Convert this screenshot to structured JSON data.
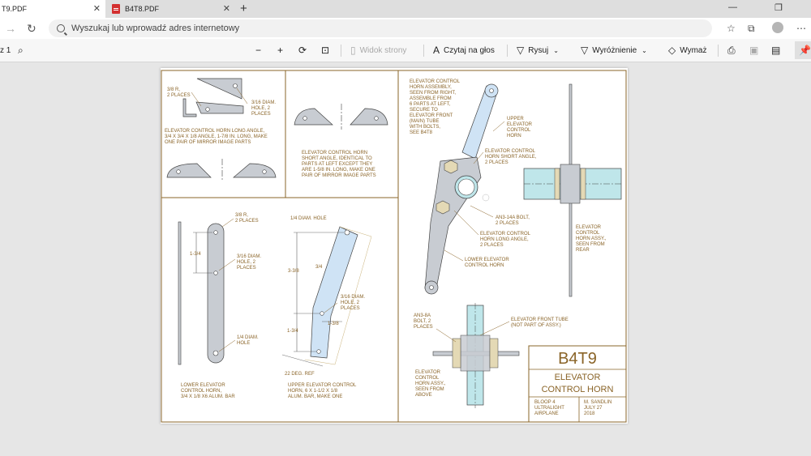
{
  "tabs": [
    {
      "label": "T9.PDF",
      "close": "✕"
    },
    {
      "label": "B4T8.PDF",
      "close": "✕"
    }
  ],
  "new_tab_glyph": "+",
  "address": {
    "placeholder": "Wyszukaj lub wprowadź adres internetowy"
  },
  "pdf_toolbar": {
    "page_indicator": "z 1",
    "page_view_label": "Widok strony",
    "read_aloud_label": "Czytaj na głos",
    "draw_label": "Rysuj",
    "highlight_label": "Wyróżnienie",
    "erase_label": "Wymaż"
  },
  "colors": {
    "accent": "#8a6428",
    "part_fill": "#c8ccd2",
    "tube_fill": "#bfe6ea",
    "horn_fill": "#cfe3f5"
  },
  "drawing": {
    "top_left": {
      "r38": "3/8 R,",
      "places2": "2 PLACES",
      "diam316": "3/16 DIAM.",
      "hole2": "HOLE, 2",
      "places": "PLACES",
      "caption": [
        "ELEVATOR CONTROL HORN  LONG ANGLE,",
        "3/4 X 3/4 X 1/8 ANGLE, 1-7/8 IN. LONG, MAKE",
        "ONE PAIR OF MIRROR IMAGE PARTS"
      ]
    },
    "top_mid": {
      "caption": [
        "ELEVATOR CONTROL HORN",
        "SHORT ANGLE, IDENTICAL TO",
        "PARTS AT LEFT EXCEPT THEY",
        "ARE 1-5/8 IN. LONG, MAKE ONE",
        "PAIR OF MIRROR IMAGE PARTS"
      ]
    },
    "lower_bar": {
      "r38": "3/8 R,",
      "places2": "2 PLACES",
      "dim134": "1-3/4",
      "diam316": "3/16 DIAM.",
      "hole2": "HOLE, 2",
      "places": "PLACES",
      "diam14": "1/4 DIAM.",
      "hole": "HOLE",
      "caption": [
        "LOWER ELEVATOR",
        "CONTROL HORN,",
        "3/4 X 1/8 X6 ALUM. BAR"
      ]
    },
    "upper_horn": {
      "diam14_hole": "1/4 DIAM. HOLE",
      "dim338": "3-3/8",
      "dim34": "3/4",
      "diam316": "3/16 DIAM.",
      "hole2": "HOLE, 2",
      "places": "PLACES",
      "dim134": "1-3/4",
      "dim138": "1-3/8",
      "deg": "22 DEG. REF",
      "caption": [
        "UPPER ELEVATOR CONTROL",
        "HORN, 6 X 1-1/2 X 1/8",
        "ALUM. BAR, MAKE ONE"
      ]
    },
    "assembly": {
      "note_lines": [
        "ELEVATOR CONTROL",
        "HORN ASSEMBLY,",
        "SEEN FROM RIGHT,",
        "ASSEMBLE FROM",
        "6 PARTS AT LEFT,",
        "SECURE TO",
        "ELEVATOR FRONT",
        "(MAIN) TUBE",
        "WITH BOLTS,",
        "SEE B4T8"
      ],
      "upper_horn_lines": [
        "UPPER",
        "ELEVATOR",
        "CONTROL",
        "HORN"
      ],
      "short_angle_lines": [
        "ELEVATOR CONTROL",
        "HORN SHORT ANGLE,",
        "2 PLACES"
      ],
      "bolt_lines": [
        "AN3-14A BOLT,",
        "2 PLACES"
      ],
      "long_angle_lines": [
        "ELEVATOR CONTROL",
        "HORN LONG ANGLE,",
        "2 PLACES"
      ],
      "lower_horn_lines": [
        "LOWER ELEVATOR",
        "CONTROL HORN"
      ],
      "rear_lines": [
        "ELEVATOR",
        "CONTROL",
        "HORN ASSY.,",
        "SEEN FROM",
        "REAR"
      ],
      "front_tube_lines": [
        "ELEVATOR FRONT TUBE",
        "(NOT PART OF ASSY.)"
      ],
      "bolt8_lines": [
        "AN3-8A",
        "BOLT, 2",
        "PLACES"
      ],
      "above_lines": [
        "ELEVATOR",
        "CONTROL",
        "HORN ASSY.,",
        "SEEN FROM",
        "ABOVE"
      ]
    },
    "title_block": {
      "number": "B4T9",
      "title1": "ELEVATOR",
      "title2": "CONTROL HORN",
      "project": [
        "BLOOP 4",
        "ULTRALIGHT",
        "AIRPLANE"
      ],
      "author": [
        "M. SANDLIN",
        "JULY 27",
        "2018"
      ]
    }
  }
}
